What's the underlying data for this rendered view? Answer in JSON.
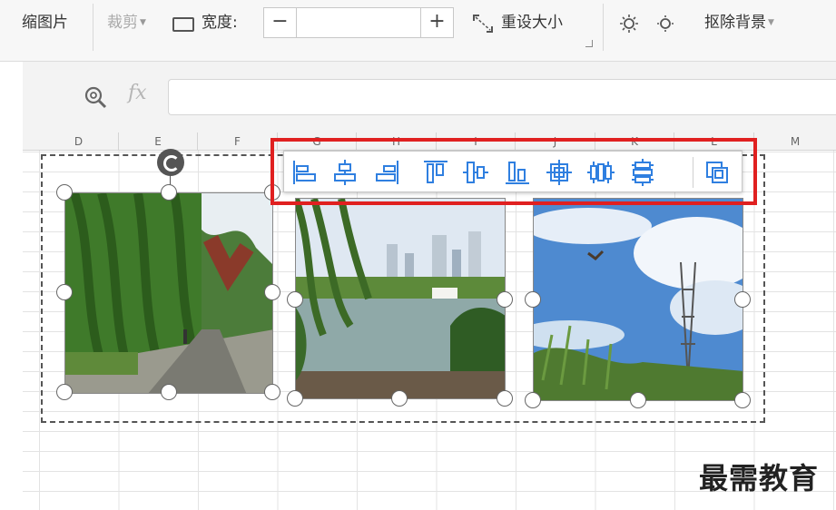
{
  "ribbon": {
    "picture_label": "缩图片",
    "crop_label": "裁剪",
    "width_label": "宽度:",
    "width_value": "",
    "minus_label": "−",
    "plus_label": "+",
    "reset_size_label": "重设大小",
    "remove_bg_label": "抠除背景"
  },
  "formula_bar": {
    "fx_label": "fx",
    "value": ""
  },
  "columns": [
    "D",
    "E",
    "F",
    "G",
    "H",
    "I",
    "J",
    "K",
    "L",
    "M"
  ],
  "align_toolbar": {
    "buttons": [
      "align-left",
      "align-center-horizontal",
      "align-right",
      "align-top",
      "align-middle-vertical",
      "align-bottom",
      "align-center",
      "distribute-horizontal",
      "distribute-vertical",
      "combine"
    ]
  },
  "images": [
    {
      "name": "willow-path-photo"
    },
    {
      "name": "lake-city-photo"
    },
    {
      "name": "sky-tower-photo"
    }
  ],
  "watermark": "最需教育",
  "colors": {
    "highlight": "#e02020",
    "icon_blue": "#2f7fe0",
    "handle_stroke": "#666666"
  }
}
